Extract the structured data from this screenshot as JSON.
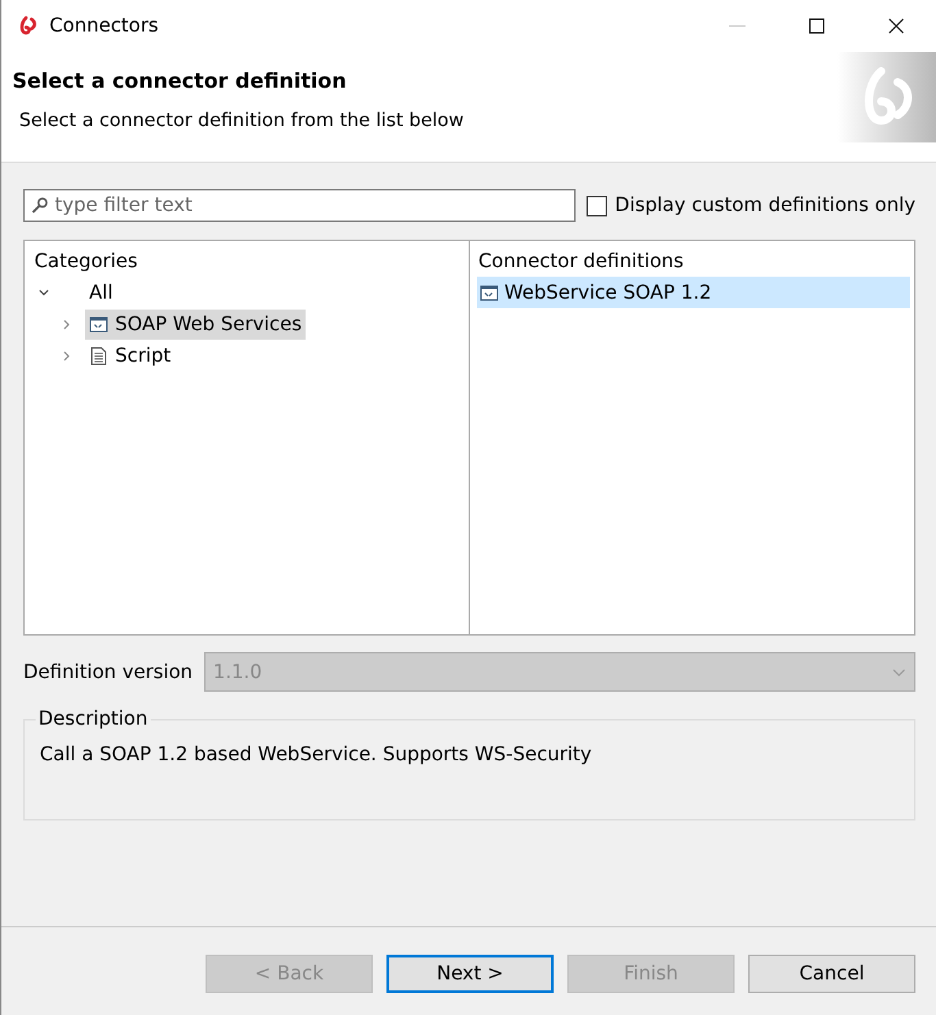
{
  "window": {
    "title": "Connectors"
  },
  "header": {
    "title": "Select a connector definition",
    "subtitle": "Select a connector definition from the list below"
  },
  "filter": {
    "placeholder": "type filter text"
  },
  "custom_only": {
    "label": "Display custom definitions only",
    "checked": false
  },
  "categories": {
    "heading": "Categories",
    "tree": [
      {
        "label": "All",
        "expanded": true,
        "selected": false,
        "children": [
          {
            "label": "SOAP Web Services",
            "expanded": false,
            "selected": true,
            "kind": "service"
          },
          {
            "label": "Script",
            "expanded": false,
            "selected": false,
            "kind": "script"
          }
        ]
      }
    ]
  },
  "definitions": {
    "heading": "Connector definitions",
    "items": [
      {
        "label": "WebService SOAP 1.2",
        "selected": true
      }
    ]
  },
  "version": {
    "label": "Definition version",
    "value": "1.1.0",
    "disabled": true
  },
  "description": {
    "legend": "Description",
    "text": "Call a SOAP 1.2 based WebService. Supports WS-Security"
  },
  "buttons": [
    {
      "label": "< Back",
      "disabled": true,
      "focused": false
    },
    {
      "label": "Next >",
      "disabled": false,
      "focused": true
    },
    {
      "label": "Finish",
      "disabled": true,
      "focused": false
    },
    {
      "label": "Cancel",
      "disabled": false,
      "focused": false
    }
  ]
}
